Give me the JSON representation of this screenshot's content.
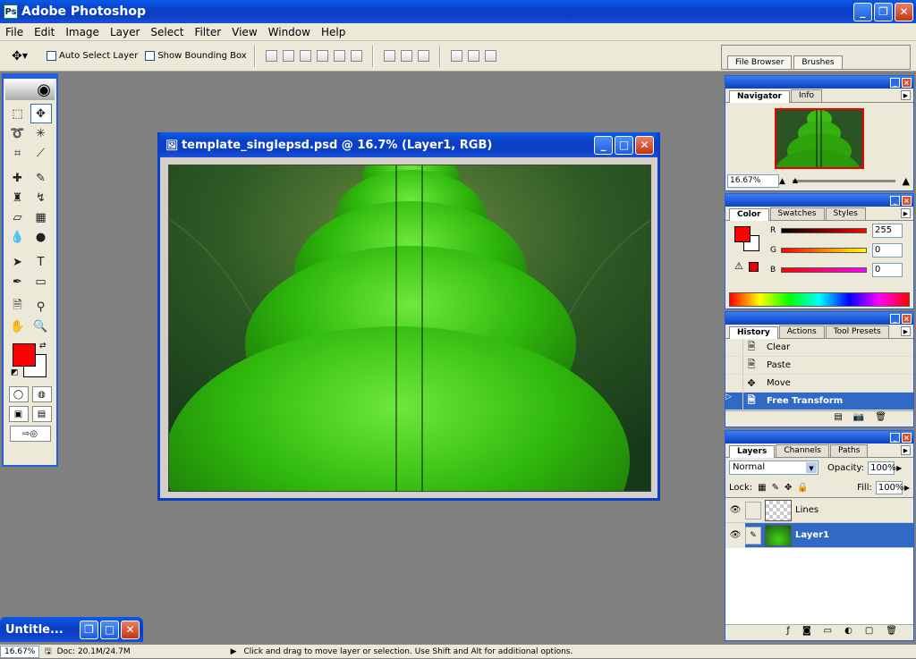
{
  "window": {
    "title": "Adobe Photoshop",
    "min_label": "_",
    "restore_label": "❐",
    "close_label": "✕"
  },
  "menu": [
    "File",
    "Edit",
    "Image",
    "Layer",
    "Select",
    "Filter",
    "View",
    "Window",
    "Help"
  ],
  "options": {
    "auto_select_label": "Auto Select Layer",
    "bounding_box_label": "Show Bounding Box"
  },
  "palette_well": {
    "tabs": [
      "File Browser",
      "Brushes"
    ]
  },
  "document": {
    "title": "template_singlepsd.psd @ 16.7% (Layer1, RGB)"
  },
  "minimized": {
    "title": "Untitle..."
  },
  "navigator": {
    "tabs": [
      "Navigator",
      "Info"
    ],
    "zoom": "16.67%"
  },
  "color": {
    "tabs": [
      "Color",
      "Swatches",
      "Styles"
    ],
    "r_label": "R",
    "g_label": "G",
    "b_label": "B",
    "r": "255",
    "g": "0",
    "b": "0",
    "foreground": "#ff0000"
  },
  "history": {
    "tabs": [
      "History",
      "Actions",
      "Tool Presets"
    ],
    "items": [
      {
        "label": "Clear"
      },
      {
        "label": "Paste"
      },
      {
        "label": "Move"
      },
      {
        "label": "Free Transform"
      }
    ]
  },
  "layers": {
    "tabs": [
      "Layers",
      "Channels",
      "Paths"
    ],
    "blend_mode": "Normal",
    "opacity_label": "Opacity:",
    "opacity": "100%",
    "lock_label": "Lock:",
    "fill_label": "Fill:",
    "fill": "100%",
    "items": [
      {
        "name": "Lines"
      },
      {
        "name": "Layer1"
      }
    ]
  },
  "status": {
    "zoom": "16.67%",
    "doc": "Doc: 20.1M/24.7M",
    "hint": "Click and drag to move layer or selection.  Use Shift and Alt for additional options."
  }
}
